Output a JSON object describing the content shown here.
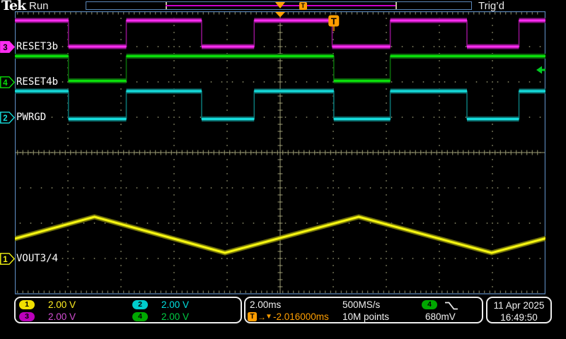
{
  "header": {
    "logo": "Tek",
    "acq_status": "Run",
    "trig_status": "Trig’d"
  },
  "acq_bar": {
    "window_start_frac": 0.205,
    "window_end_frac": 0.804,
    "expansion_frac": 0.503,
    "trigger_frac": 0.563,
    "trigger_icon": "T",
    "line_color": "#cc00cc",
    "bracket_color": "#c4bb9e"
  },
  "display": {
    "frame_color": "#5a86b8",
    "grid_color": "#8f8f6d",
    "axis_color": "#9a9a72",
    "bg": "#000000"
  },
  "readouts": {
    "channels": [
      {
        "n": "1",
        "scale": "2.00 V",
        "color": "#ffee22",
        "badge": "#f0e000"
      },
      {
        "n": "2",
        "scale": "2.00 V",
        "color": "#00e0e0",
        "badge": "#00cccc"
      },
      {
        "n": "3",
        "scale": "2.00 V",
        "color": "#d24fd2",
        "badge": "#bb00bb"
      },
      {
        "n": "4",
        "scale": "2.00 V",
        "color": "#00cc44",
        "badge": "#00a800"
      }
    ],
    "horizontal": {
      "timebase": "2.00ms",
      "sample_rate": "500MS/s",
      "record_length": "10M points",
      "delay": "-2.016000ms"
    },
    "trigger": {
      "t_icon": "T",
      "arrow_icon": "→",
      "expansion_icon": "▼",
      "source_n": "4",
      "source_badge": "#00a800",
      "level": "680mV",
      "slope": "falling",
      "accent": "#ff9e00"
    },
    "datetime": {
      "date": "11 Apr 2025",
      "time": "16:49:50"
    }
  },
  "chart_data": {
    "type": "oscilloscope",
    "time_per_div_ms": 2.0,
    "volts_per_div": 2.0,
    "t_range_ms": [
      -10,
      10
    ],
    "divisions": {
      "h": 10,
      "v": 8
    },
    "digital_channels": [
      {
        "ch": "3",
        "name": "RESET3b",
        "color": "#ff2df2",
        "dim": "#8a1186",
        "ground_div": 1,
        "high_v": 1.48,
        "low_v": 0.0,
        "initial_level": "high",
        "selected": true,
        "edge_times_ms": [
          -7.98,
          -5.8,
          -2.96,
          -0.98,
          1.96,
          4.15,
          7.04,
          9.0
        ]
      },
      {
        "ch": "4",
        "name": "RESET4b",
        "color": "#0ae00a",
        "dim": "#0b6b0b",
        "ground_div": 2,
        "high_v": 1.46,
        "low_v": 0.06,
        "initial_level": "high",
        "selected": false,
        "edge_times_ms": [
          -7.98,
          -5.8,
          2.02,
          4.15
        ]
      },
      {
        "ch": "2",
        "name": "PWRGD",
        "color": "#16dede",
        "dim": "#0a7171",
        "ground_div": 3,
        "high_v": 1.48,
        "low_v": -0.1,
        "initial_level": "high",
        "selected": false,
        "edge_times_ms": [
          -7.98,
          -5.8,
          -2.96,
          -0.98,
          2.02,
          4.15,
          7.04,
          9.0
        ]
      }
    ],
    "analog_channels": [
      {
        "ch": "1",
        "name": "VOUT3/4",
        "color": "#f5f512",
        "dim": "#85850a",
        "ground_div": 7,
        "selected": false,
        "points_t_v": [
          [
            -10,
            1.12
          ],
          [
            -7.0,
            2.36
          ],
          [
            -2.08,
            0.32
          ],
          [
            2.96,
            2.36
          ],
          [
            7.97,
            0.32
          ],
          [
            10,
            1.14
          ]
        ]
      }
    ],
    "trigger": {
      "t_ms": 2.02,
      "level_v": 0.68,
      "source_ch": "4",
      "color": "#00cc22"
    }
  }
}
